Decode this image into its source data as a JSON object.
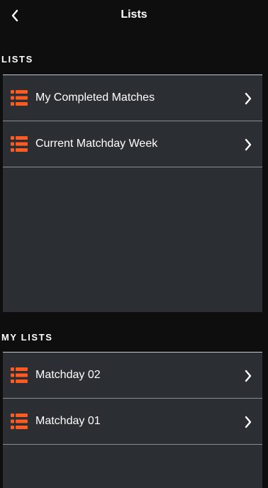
{
  "header": {
    "title": "Lists",
    "back_icon": "chevron-left-icon"
  },
  "sections": [
    {
      "title": "LISTS",
      "items": [
        {
          "label": "My Completed Matches",
          "icon": "list-icon",
          "chevron": "chevron-right-icon"
        },
        {
          "label": "Current Matchday Week",
          "icon": "list-icon",
          "chevron": "chevron-right-icon"
        }
      ]
    },
    {
      "title": "MY LISTS",
      "items": [
        {
          "label": "Matchday 02",
          "icon": "list-icon",
          "chevron": "chevron-right-icon"
        },
        {
          "label": "Matchday 01",
          "icon": "list-icon",
          "chevron": "chevron-right-icon"
        }
      ]
    }
  ],
  "colors": {
    "background": "#0e0e0e",
    "panel": "#2b2f33",
    "accent": "#ff5a1f",
    "text": "#ffffff"
  }
}
